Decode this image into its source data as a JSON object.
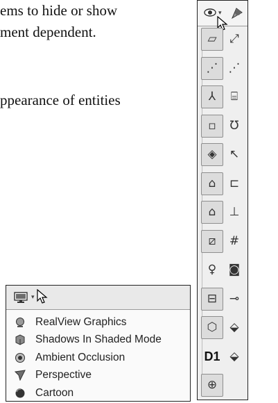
{
  "document": {
    "line1": "ems to hide or show",
    "line2": "ment dependent.",
    "line3": "ppearance of entities"
  },
  "toolbar": {
    "top_left_icon": "eye-icon",
    "top_right_icon": "hide-show-icon",
    "dropdown_indicator": "▾",
    "buttons": [
      {
        "name": "plane-icon",
        "glyph": "▱"
      },
      {
        "name": "axis-icon",
        "glyph": "⤢"
      },
      {
        "name": "temporary-axes-icon",
        "glyph": "⋰"
      },
      {
        "name": "axes-dim-icon",
        "glyph": "⋰"
      },
      {
        "name": "coordinate-system-icon",
        "glyph": "⅄"
      },
      {
        "name": "dimension-names-icon",
        "glyph": "⌸"
      },
      {
        "name": "point-icon",
        "glyph": "▫"
      },
      {
        "name": "curve-icon",
        "glyph": "Ʊ"
      },
      {
        "name": "origin-icon",
        "glyph": "◈"
      },
      {
        "name": "sketch-relations-icon",
        "glyph": "↖"
      },
      {
        "name": "annotation-view-icon",
        "glyph": "⌂"
      },
      {
        "name": "sketch-icon",
        "glyph": "⊏"
      },
      {
        "name": "annotation-link-icon",
        "glyph": "⌂"
      },
      {
        "name": "weld-icon",
        "glyph": "⊥"
      },
      {
        "name": "3d-sketch-icon",
        "glyph": "⧄"
      },
      {
        "name": "grid-icon",
        "glyph": "#"
      },
      {
        "name": "lights-icon",
        "glyph": "♀"
      },
      {
        "name": "cameras-icon",
        "glyph": "◙"
      },
      {
        "name": "routing-icon",
        "glyph": "⊟"
      },
      {
        "name": "routing-point-icon",
        "glyph": "⊸"
      },
      {
        "name": "view-3d-icon",
        "glyph": "⬡"
      },
      {
        "name": "decals-icon",
        "glyph": "⬙"
      },
      {
        "name": "d1-label",
        "glyph": "D1"
      },
      {
        "name": "part-icon",
        "glyph": "⬙"
      },
      {
        "name": "center-of-mass-icon",
        "glyph": "⊕"
      }
    ]
  },
  "panel": {
    "head_icon": "monitor-icon",
    "dropdown_indicator": "▾",
    "menu_items": [
      {
        "label": "RealView Graphics",
        "icon": "realview-graphics-icon"
      },
      {
        "label": "Shadows In Shaded Mode",
        "icon": "shadows-icon"
      },
      {
        "label": "Ambient Occlusion",
        "icon": "ambient-occlusion-icon"
      },
      {
        "label": "Perspective",
        "icon": "perspective-icon"
      },
      {
        "label": "Cartoon",
        "icon": "cartoon-icon"
      }
    ]
  },
  "colors": {
    "panel_bg": "#fafafa",
    "toolbar_bg": "#efefef",
    "border": "#222222"
  }
}
